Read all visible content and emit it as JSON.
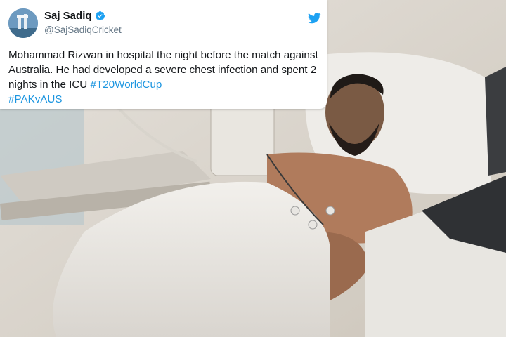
{
  "tweet": {
    "display_name": "Saj Sadiq",
    "handle": "@SajSadiqCricket",
    "text": "Mohammad Rizwan in hospital the night before the match against Australia. He had developed a severe chest infection and spent 2 nights in the ICU",
    "hashtags": [
      "#T20WorldCup",
      "#PAKvAUS"
    ],
    "verified": true,
    "avatar_icon": "avatar-image",
    "logo_icon": "twitter-bird-icon"
  },
  "colors": {
    "text": "#14171a",
    "secondary": "#657786",
    "link": "#1b95e0",
    "verified": "#1da1f2",
    "brand": "#1da1f2"
  },
  "photo": {
    "subject": "hospital-bed-photo"
  }
}
